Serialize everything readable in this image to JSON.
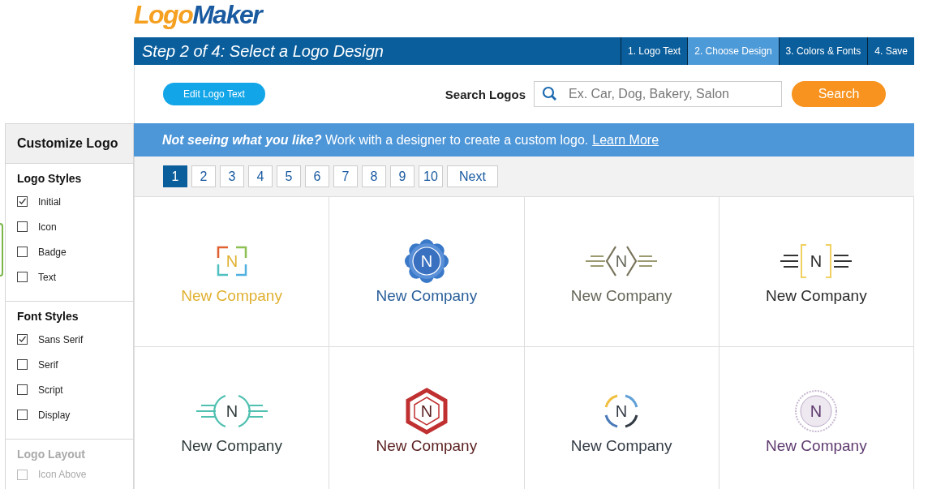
{
  "brand": {
    "part_1": "Logo",
    "part_2": "Maker"
  },
  "header": {
    "title": "Step 2 of 4: Select a Logo Design",
    "steps": [
      {
        "label": "1. Logo Text",
        "selected": false
      },
      {
        "label": "2. Choose Design",
        "selected": true
      },
      {
        "label": "3. Colors & Fonts",
        "selected": false
      },
      {
        "label": "4. Save",
        "selected": false
      }
    ]
  },
  "toolbar": {
    "edit_button": "Edit Logo Text",
    "search_label": "Search Logos",
    "search": {
      "placeholder": "Ex. Car, Dog, Bakery, Salon"
    },
    "search_button": "Search"
  },
  "banner": {
    "text": "**Not seeing what you like?** Work with a designer to create a custom logo.",
    "link": "Learn More"
  },
  "pagination": {
    "pages": [
      {
        "label": "1",
        "selected": true
      },
      {
        "label": "2",
        "selected": false
      },
      {
        "label": "3",
        "selected": false
      },
      {
        "label": "4",
        "selected": false
      },
      {
        "label": "5",
        "selected": false
      },
      {
        "label": "6",
        "selected": false
      },
      {
        "label": "7",
        "selected": false
      },
      {
        "label": "8",
        "selected": false
      },
      {
        "label": "9",
        "selected": false
      },
      {
        "label": "10",
        "selected": false
      }
    ],
    "next": "Next"
  },
  "sidebar": {
    "title": "Customize Logo",
    "sections": [
      {
        "title": "Logo Styles",
        "disabled": false,
        "items": [
          {
            "label": "Initial",
            "checked": true
          },
          {
            "label": "Icon",
            "checked": false
          },
          {
            "label": "Badge",
            "checked": false
          },
          {
            "label": "Text",
            "checked": false
          }
        ]
      },
      {
        "title": "Font Styles",
        "disabled": false,
        "items": [
          {
            "label": "Sans Serif",
            "checked": true
          },
          {
            "label": "Serif",
            "checked": false
          },
          {
            "label": "Script",
            "checked": false
          },
          {
            "label": "Display",
            "checked": false
          }
        ]
      },
      {
        "title": "Logo Layout",
        "disabled": true,
        "items": [
          {
            "label": "Icon Above",
            "checked": false
          }
        ]
      }
    ]
  },
  "logos": [
    {
      "kind": "corners",
      "initial": "N",
      "name": "New Company",
      "color": "#e0b030"
    },
    {
      "kind": "flower",
      "initial": "N",
      "name": "New Company",
      "color": "#2a5f9a"
    },
    {
      "kind": "chevrons",
      "initial": "N",
      "name": "New Company",
      "color": "#66665a"
    },
    {
      "kind": "brackets",
      "initial": "N",
      "name": "New Company",
      "color": "#2a2a2a"
    },
    {
      "kind": "wings",
      "initial": "N",
      "name": "New Company",
      "color": "#2f3b3b"
    },
    {
      "kind": "hexagon",
      "initial": "N",
      "name": "New Company",
      "color": "#5a1f1f"
    },
    {
      "kind": "ring",
      "initial": "N",
      "name": "New Company",
      "color": "#333b45"
    },
    {
      "kind": "seal",
      "initial": "N",
      "name": "New Company",
      "color": "#5e3a6e"
    }
  ]
}
